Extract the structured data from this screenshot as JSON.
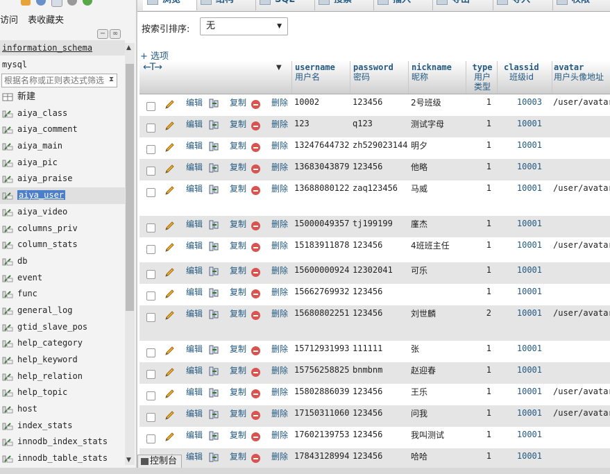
{
  "nav": {
    "links": [
      "访问",
      "表收藏夹"
    ],
    "databases": [
      "information_schema",
      "mysql"
    ],
    "filter_placeholder": "根据名称或正则表达式筛选",
    "new_label": "新建",
    "tables": [
      "aiya_class",
      "aiya_comment",
      "aiya_main",
      "aiya_pic",
      "aiya_praise",
      "aiya_user",
      "aiya_video",
      "columns_priv",
      "column_stats",
      "db",
      "event",
      "func",
      "general_log",
      "gtid_slave_pos",
      "help_category",
      "help_keyword",
      "help_relation",
      "help_topic",
      "host",
      "index_stats",
      "innodb_index_stats",
      "innodb_table_stats"
    ],
    "selected_table": "aiya_user"
  },
  "tabs": [
    "浏览",
    "结构",
    "SQL",
    "搜索",
    "插入",
    "导出",
    "导入",
    "权限"
  ],
  "sort": {
    "label": "按索引排序:",
    "value": "无"
  },
  "options_link": "+ 选项",
  "col_arrows": "←T→",
  "actions": {
    "edit": "编辑",
    "copy": "复制",
    "delete": "删除"
  },
  "columns": [
    {
      "en": "username",
      "cn": "用户名"
    },
    {
      "en": "password",
      "cn": "密码"
    },
    {
      "en": "nickname",
      "cn": "昵称"
    },
    {
      "en": "type",
      "cn": "用户类型"
    },
    {
      "en": "classid",
      "cn": "班级id"
    },
    {
      "en": "avatar",
      "cn": "用户头像地址"
    }
  ],
  "rows": [
    {
      "username": "10002",
      "password": "123456",
      "nickname": "2号班级",
      "type": "1",
      "classid": "10003",
      "avatar": "/user/avatar"
    },
    {
      "username": "123",
      "password": "q123",
      "nickname": "测试字母",
      "type": "1",
      "classid": "10001",
      "avatar": ""
    },
    {
      "username": "13247644732",
      "password": "zh529023144",
      "nickname": "明夕",
      "type": "1",
      "classid": "10001",
      "avatar": ""
    },
    {
      "username": "13683043879",
      "password": "123456",
      "nickname": "他略",
      "type": "1",
      "classid": "10001",
      "avatar": ""
    },
    {
      "username": "13688080122",
      "password": "zaq123456",
      "nickname": "马威",
      "type": "1",
      "classid": "10001",
      "avatar": "/user/avatar"
    },
    {
      "username": "15000049357",
      "password": "tj199199",
      "nickname": "廑杰",
      "type": "1",
      "classid": "10001",
      "avatar": ""
    },
    {
      "username": "15183911878",
      "password": "123456",
      "nickname": "4班班主任",
      "type": "1",
      "classid": "10001",
      "avatar": "/user/avatar"
    },
    {
      "username": "15600000924",
      "password": "12302041",
      "nickname": "可乐",
      "type": "1",
      "classid": "10001",
      "avatar": ""
    },
    {
      "username": "15662769932",
      "password": "123456",
      "nickname": "",
      "type": "1",
      "classid": "10001",
      "avatar": ""
    },
    {
      "username": "15680802251",
      "password": "123456",
      "nickname": "刘世麟",
      "type": "2",
      "classid": "10001",
      "avatar": "/user/avatar"
    },
    {
      "username": "15712931993",
      "password": "111111",
      "nickname": "张",
      "type": "1",
      "classid": "10001",
      "avatar": ""
    },
    {
      "username": "15756258825",
      "password": "bnmbnm",
      "nickname": "赵迎春",
      "type": "1",
      "classid": "10001",
      "avatar": ""
    },
    {
      "username": "15802886039",
      "password": "123456",
      "nickname": "王乐",
      "type": "1",
      "classid": "10001",
      "avatar": "/user/avatar"
    },
    {
      "username": "17150311060",
      "password": "123456",
      "nickname": "问我",
      "type": "1",
      "classid": "10001",
      "avatar": "/user/avatar"
    },
    {
      "username": "17602139753",
      "password": "123456",
      "nickname": "我叫测试",
      "type": "1",
      "classid": "10001",
      "avatar": ""
    },
    {
      "username": "17843128994",
      "password": "123456",
      "nickname": "哈哈",
      "type": "1",
      "classid": "10001",
      "avatar": ""
    }
  ],
  "console_label": "控制台"
}
